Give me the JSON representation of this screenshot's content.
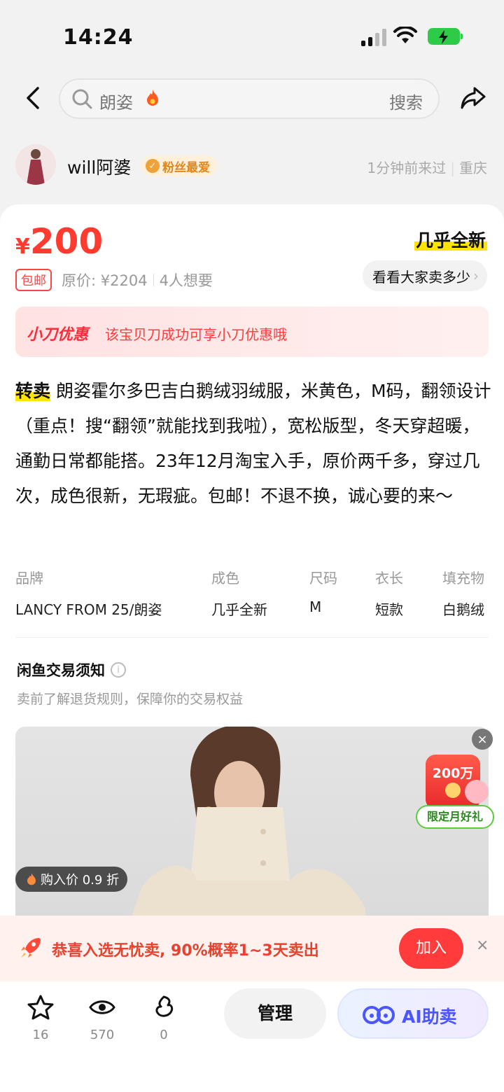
{
  "status": {
    "time": "14:24"
  },
  "nav": {
    "query": "朗姿",
    "search_label": "搜索"
  },
  "seller": {
    "name": "will阿婆",
    "badge": "粉丝最爱",
    "visit": "1分钟前来过",
    "city": "重庆"
  },
  "item": {
    "price_symbol": "¥",
    "price": "200",
    "condition": "几乎全新",
    "shipping_tag": "包邮",
    "original_price": "原价: ¥2204",
    "wants": "4人想要",
    "see_prices": "看看大家卖多少",
    "coupon_title": "小刀优惠",
    "coupon_desc": "该宝贝刀成功可享小刀优惠哦",
    "desc_tag": "转卖",
    "description": "朗姿霍尔多巴吉白鹅绒羽绒服，米黄色，M码，翻领设计（重点！搜“翻领”就能找到我啦），宽松版型，冬天穿超暖，通勤日常都能搭。23年12月淘宝入手，原价两千多，穿过几次，成色很新，无瑕疵。包邮！不退不换，诚心要的来～",
    "attributes": [
      {
        "k": "品牌",
        "v": "LANCY FROM 25/朗姿"
      },
      {
        "k": "成色",
        "v": "几乎全新"
      },
      {
        "k": "尺码",
        "v": "M"
      },
      {
        "k": "衣长",
        "v": "短款"
      },
      {
        "k": "填充物",
        "v": "白鹅绒"
      }
    ]
  },
  "notice": {
    "title": "闲鱼交易须知",
    "subtitle": "卖前了解退货规则，保障你的交易权益"
  },
  "ad": {
    "buy_chip": "购入价 0.9 折",
    "promo_amount": "200万",
    "promo_label": "限定月好礼",
    "close": "×"
  },
  "banner": {
    "text": "恭喜入选无忧卖, 90%概率1~3天卖出",
    "join": "加入",
    "close": "×"
  },
  "bottom": {
    "fav_count": "16",
    "view_count": "570",
    "like_count": "0",
    "manage": "管理",
    "ai": "AI助卖"
  },
  "colors": {
    "price": "#ff3b30",
    "highlight": "#ffe500",
    "accent_blue": "#4b56ff"
  }
}
